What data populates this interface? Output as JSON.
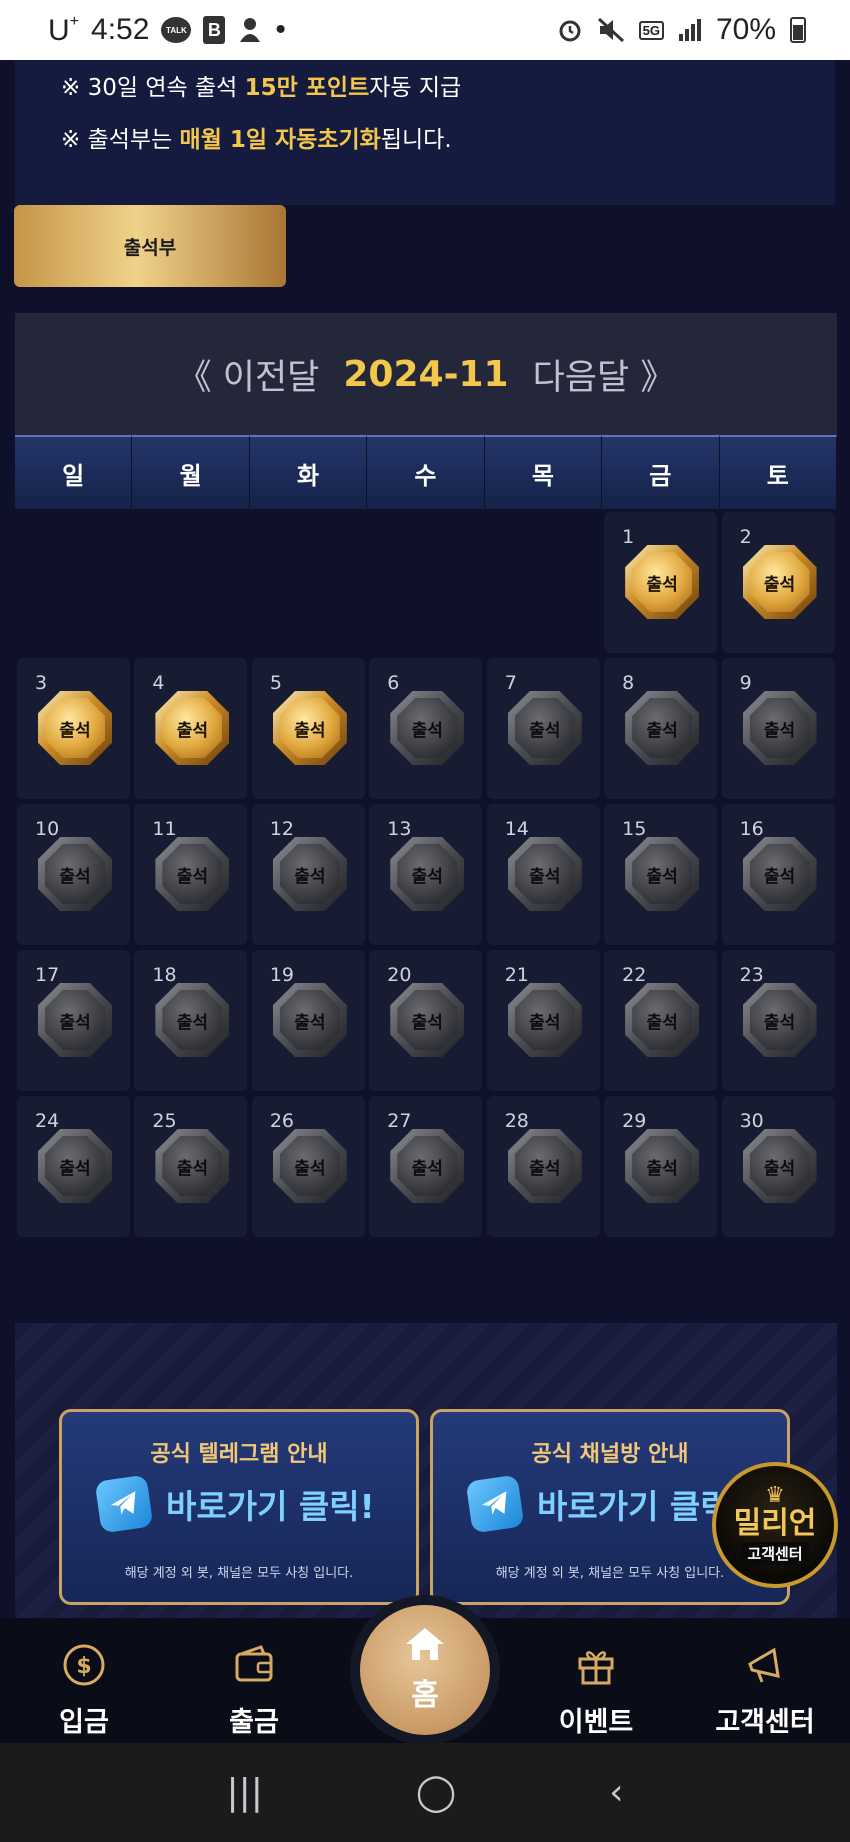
{
  "status_bar": {
    "carrier": "U",
    "carrier_sup": "+",
    "time": "4:52",
    "talk": "TALK",
    "b_app": "B",
    "dot": "•",
    "network": "5G",
    "battery": "70%"
  },
  "info": {
    "line1": {
      "prefix": "※ 30일 연속 출석 ",
      "highlight": "15만 포인트",
      "suffix": "자동 지급"
    },
    "line2": {
      "prefix": "※ 출석부는 ",
      "highlight": "매월 1일 자동초기화",
      "suffix": "됩니다."
    }
  },
  "attendance_button": "출석부",
  "calendar": {
    "prev": "《 이전달",
    "month": "2024-11",
    "next": "다음달 》",
    "weekdays": [
      "일",
      "월",
      "화",
      "수",
      "목",
      "금",
      "토"
    ],
    "stamp_label": "출석",
    "first_weekday": 5,
    "days_in_month": 30,
    "checked_days": [
      1,
      2,
      3,
      4,
      5
    ]
  },
  "banners": [
    {
      "title": "공식 텔레그램 안내",
      "cta": "바로가기 클릭!",
      "note": "해당 계정 외 봇, 채널은 모두 사칭 입니다."
    },
    {
      "title": "공식 채널방 안내",
      "cta": "바로가기 클릭!",
      "note": "해당 계정 외 봇, 채널은 모두 사칭 입니다."
    }
  ],
  "support_badge": {
    "name": "밀리언",
    "sub": "고객센터"
  },
  "bottom_nav": {
    "deposit": "입금",
    "withdraw": "출금",
    "home": "홈",
    "event": "이벤트",
    "support": "고객센터"
  },
  "android_nav": {
    "recent": "|||",
    "home": "◯",
    "back": "‹"
  },
  "colors": {
    "background": "#0e1129",
    "gold": "#f2c74b",
    "panel": "#151a3f",
    "weekday_header": "#1c2c5c"
  }
}
